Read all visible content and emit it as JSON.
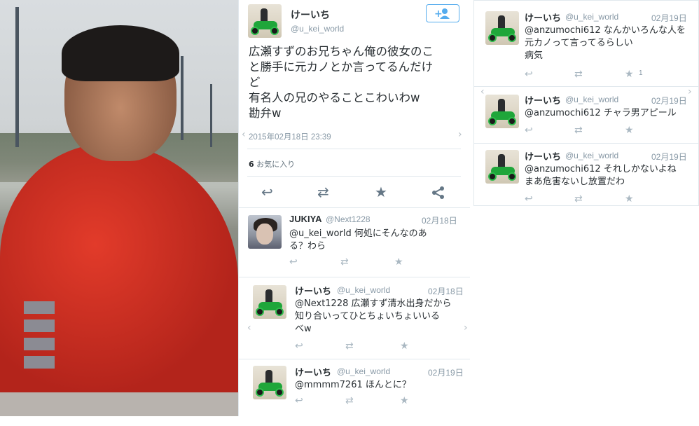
{
  "main_tweet": {
    "name": "けーいち",
    "handle": "@u_kei_world",
    "follow_icon": "follow-person-plus-icon",
    "text": "広瀬すずのお兄ちゃん俺の彼女のこ\nと勝手に元カノとか言ってるんだけ\nど\n有名人の兄のやることこわいわw\n勘弁w",
    "timestamp": "2015年02月18日 23:39",
    "favorites_count": "6",
    "favorites_label": "お気に入り"
  },
  "replies_mid": [
    {
      "name": "JUKIYA",
      "handle": "@Next1228",
      "date": "02月18日",
      "text": "@u_kei_world 何処にそんなのあ\nる？わら"
    },
    {
      "name": "けーいち",
      "handle": "@u_kei_world",
      "date": "02月18日",
      "text": "@Next1228 広瀬すず清水出身だから\n知り合いってひとちょいちょいいる\nべw"
    },
    {
      "name": "けーいち",
      "handle": "@u_kei_world",
      "date": "02月19日",
      "text": "@mmmm7261 ほんとに？"
    }
  ],
  "replies_right": [
    {
      "name": "けーいち",
      "handle": "@u_kei_world",
      "date": "02月19日",
      "text": "@anzumochi612 なんかいろんな人を\n元カノって言ってるらしい\n病気",
      "fav_count": "1"
    },
    {
      "name": "けーいち",
      "handle": "@u_kei_world",
      "date": "02月19日",
      "text": "@anzumochi612 チャラ男アピール"
    },
    {
      "name": "けーいち",
      "handle": "@u_kei_world",
      "date": "02月19日",
      "text": "@anzumochi612 それしかないよね\nまあ危害ないし放置だわ"
    }
  ],
  "icons": {
    "reply": "↩",
    "retweet": "⇄",
    "favorite": "★",
    "share": "share-icon",
    "chevron_left": "‹",
    "chevron_right": "›"
  },
  "colors": {
    "accent": "#55acee",
    "muted": "#8899a6",
    "action": "#aab8c2"
  }
}
